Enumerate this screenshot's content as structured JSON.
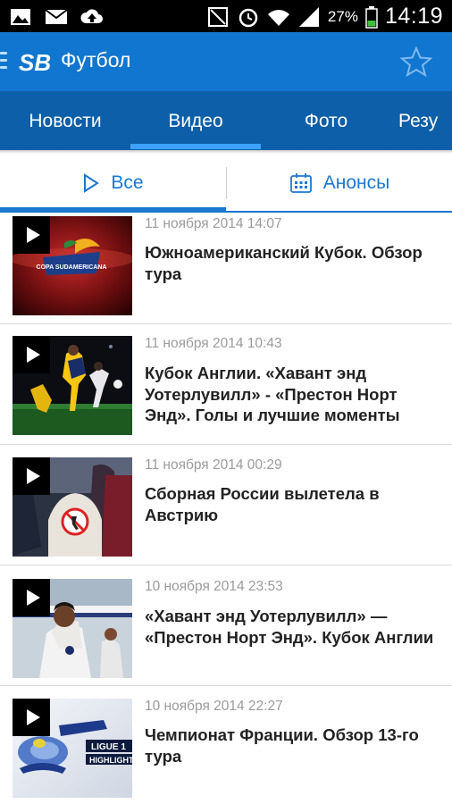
{
  "status_bar": {
    "battery": "27%",
    "time": "14:19",
    "icons": [
      "image-icon",
      "mail-icon",
      "cloud-upload-icon",
      "nfc-icon",
      "alarm-icon",
      "wifi-icon",
      "signal-icon",
      "battery-icon"
    ]
  },
  "app_bar": {
    "logo": "SB",
    "title": "Футбол",
    "icons": [
      "menu-icon",
      "star-icon"
    ]
  },
  "category_tabs": [
    {
      "label": "Новости"
    },
    {
      "label": "Видео"
    },
    {
      "label": "Фото"
    },
    {
      "label": "Резу"
    }
  ],
  "selected_category": "Видео",
  "sub_tabs": [
    {
      "label": "Все",
      "icon": "play-outline-icon"
    },
    {
      "label": "Анонсы",
      "icon": "calendar-icon"
    }
  ],
  "selected_sub_tab": "Все",
  "videos": [
    {
      "date": "11 ноября 2014 14:07",
      "title": "Южноамериканский Кубок. Обзор тура",
      "thumb_text": "COPA SUDAMERICANA"
    },
    {
      "date": "11 ноября 2014 10:43",
      "title": "Кубок Англии. «Хавант энд Уотерлувилл» - «Престон Норт Энд». Голы и лучшие моменты"
    },
    {
      "date": "11 ноября 2014 00:29",
      "title": "Сборная России вылетела в Австрию"
    },
    {
      "date": "10 ноября 2014 23:53",
      "title": "«Хавант энд Уотерлувилл» — «Престон Норт Энд». Кубок Англии"
    },
    {
      "date": "10 ноября 2014 22:27",
      "title": "Чемпионат Франции. Обзор 13-го тура",
      "thumb_text": [
        "LIGUE 1",
        "HIGHLIGHT"
      ]
    }
  ],
  "colors": {
    "app_bar": "#1176cf",
    "tab_bar": "#0c5fa8",
    "tab_indicator": "#3da2ff",
    "sub_tab_accent": "#1a78d0",
    "date_text": "#9b9b9b",
    "title_text": "#222222"
  }
}
